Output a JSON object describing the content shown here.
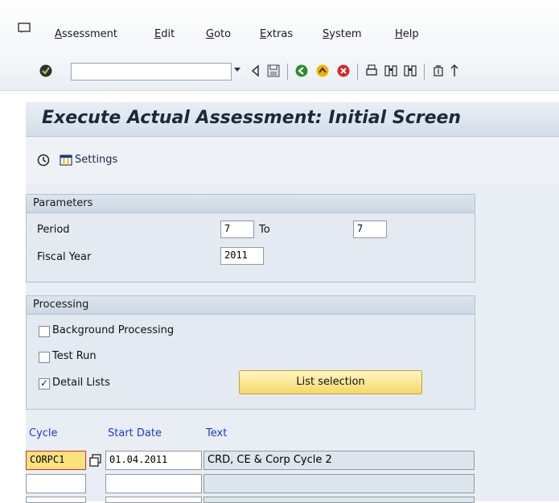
{
  "menu": {
    "items": [
      "Assessment",
      "Edit",
      "Goto",
      "Extras",
      "System",
      "Help"
    ]
  },
  "toolbar": {
    "command_value": "",
    "icons": [
      "check-icon",
      "dropdown-icon",
      "back-triangle-icon",
      "save-icon",
      "back-icon",
      "exit-icon",
      "cancel-icon",
      "print-icon",
      "find-icon",
      "find-next-icon",
      "first-page-icon",
      "prev-page-icon"
    ]
  },
  "title": "Execute Actual Assessment: Initial Screen",
  "app_toolbar": {
    "settings_label": "Settings"
  },
  "parameters": {
    "title": "Parameters",
    "period_label": "Period",
    "period_from": "7",
    "to_label": "To",
    "period_to": "7",
    "fiscal_year_label": "Fiscal Year",
    "fiscal_year": "2011"
  },
  "processing": {
    "title": "Processing",
    "background_label": "Background Processing",
    "background_checked": false,
    "test_run_label": "Test Run",
    "test_run_checked": false,
    "detail_lists_label": "Detail Lists",
    "detail_lists_checked": true,
    "list_selection_label": "List selection"
  },
  "cycle_table": {
    "headers": [
      "Cycle",
      "Start Date",
      "Text"
    ],
    "rows": [
      {
        "cycle": "CORPC1",
        "start_date": "01.04.2011",
        "text": "CRD, CE & Corp Cycle 2"
      },
      {
        "cycle": "",
        "start_date": "",
        "text": ""
      },
      {
        "cycle": "",
        "start_date": "",
        "text": ""
      }
    ]
  },
  "colors": {
    "title_bg": "#d4dee9",
    "header_blue": "#1d3bd6",
    "button_yellow": "#f6d86a",
    "cycle_highlight": "#fbe27a",
    "cycle_border": "#e03030"
  }
}
